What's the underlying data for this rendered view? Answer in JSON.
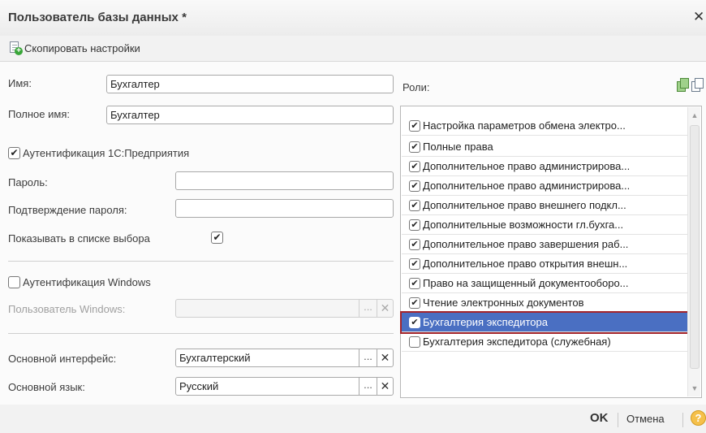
{
  "window": {
    "title": "Пользователь базы данных *"
  },
  "toolbar": {
    "copy_label": "Скопировать настройки"
  },
  "form": {
    "name_label": "Имя:",
    "name_value": "Бухгалтер",
    "fullname_label": "Полное имя:",
    "fullname_value": "Бухгалтер",
    "auth_1c_label": "Аутентификация 1С:Предприятия",
    "auth_1c_checked": "✔",
    "password_label": "Пароль:",
    "password_value": "",
    "confirm_label": "Подтверждение пароля:",
    "confirm_value": "",
    "show_in_list_label": "Показывать в списке выбора",
    "show_in_list_checked": "✔",
    "auth_windows_label": "Аутентификация Windows",
    "auth_windows_checked": "",
    "windows_user_label": "Пользователь Windows:",
    "windows_user_value": "",
    "interface_label": "Основной интерфейс:",
    "interface_value": "Бухгалтерский",
    "language_label": "Основной язык:",
    "language_value": "Русский",
    "dots": "...",
    "clear": "✕"
  },
  "roles": {
    "label": "Роли:",
    "items": [
      {
        "label": "Настройка параметров обмена электро...",
        "checked": "✔"
      },
      {
        "label": "Полные права",
        "checked": "✔"
      },
      {
        "label": "Дополнительное право администрирова...",
        "checked": "✔"
      },
      {
        "label": "Дополнительное право администрирова...",
        "checked": "✔"
      },
      {
        "label": "Дополнительное право внешнего подкл...",
        "checked": "✔"
      },
      {
        "label": "Дополнительные возможности гл.бухга...",
        "checked": "✔"
      },
      {
        "label": "Дополнительное право завершения раб...",
        "checked": "✔"
      },
      {
        "label": "Дополнительное право открытия внешн...",
        "checked": "✔"
      },
      {
        "label": "Право на защищенный документооборо...",
        "checked": "✔"
      },
      {
        "label": "Чтение электронных документов",
        "checked": "✔"
      },
      {
        "label": "Бухгалтерия экспедитора",
        "checked": "✔"
      },
      {
        "label": "Бухгалтерия экспедитора (служебная)",
        "checked": ""
      }
    ],
    "selected_index": 10
  },
  "footer": {
    "ok_label": "OK",
    "cancel_label": "Отмена",
    "help_label": "?"
  },
  "colors": {
    "selection": "#4a6fc2",
    "selection_outline": "#a3242b",
    "help": "#f5c04a"
  }
}
